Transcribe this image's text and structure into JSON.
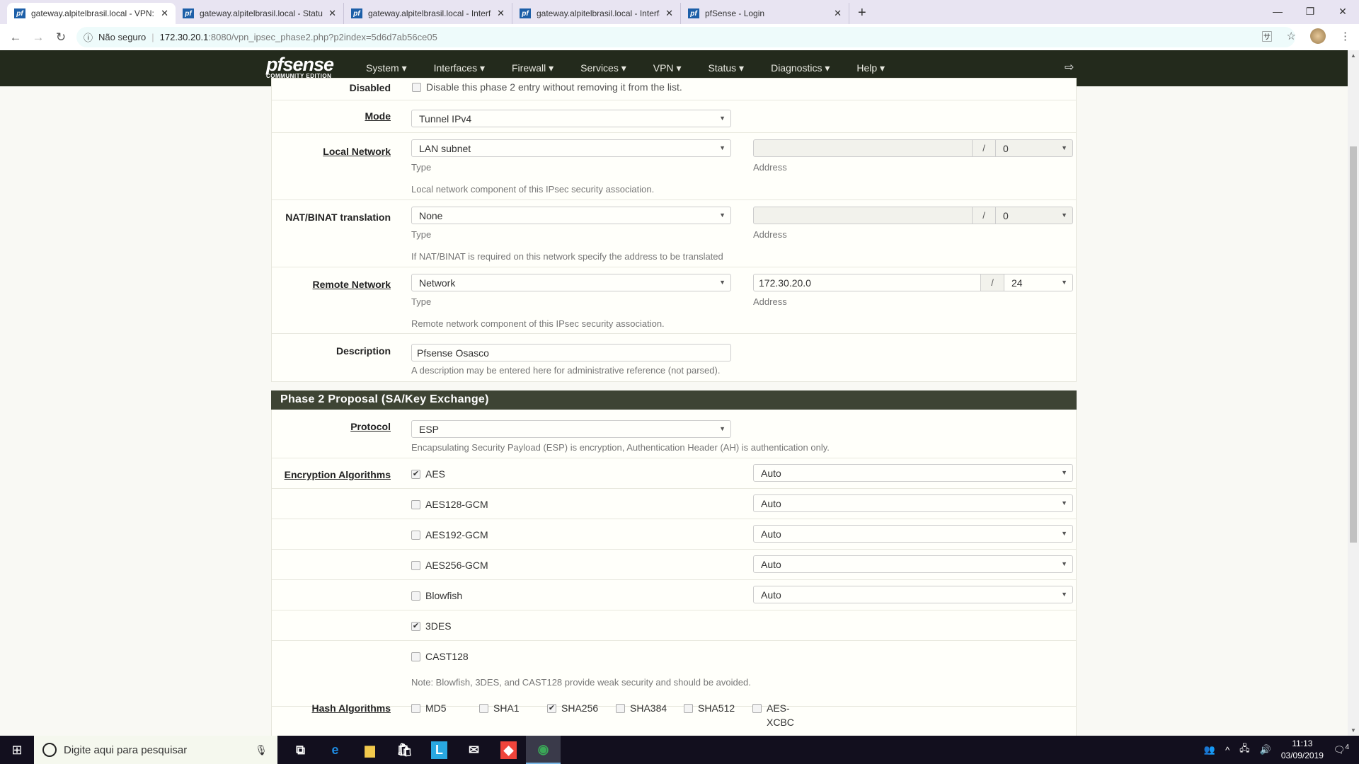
{
  "browser": {
    "tabs": [
      {
        "title": "gateway.alpitelbrasil.local - VPN: IPsec",
        "active": true
      },
      {
        "title": "gateway.alpitelbrasil.local - Status",
        "active": false
      },
      {
        "title": "gateway.alpitelbrasil.local - Interfaces",
        "active": false
      },
      {
        "title": "gateway.alpitelbrasil.local - Interfaces",
        "active": false
      },
      {
        "title": "pfSense - Login",
        "active": false
      }
    ],
    "security": "Não seguro",
    "url_host": "172.30.20.1",
    "url_path": ":8080/vpn_ipsec_phase2.php?p2index=5d6d7ab56ce05"
  },
  "navbar": {
    "logo": "pfsense",
    "edition": "COMMUNITY EDITION",
    "menu": [
      "System ▾",
      "Interfaces ▾",
      "Firewall ▾",
      "Services ▾",
      "VPN ▾",
      "Status ▾",
      "Diagnostics ▾",
      "Help ▾"
    ]
  },
  "form": {
    "disabled": {
      "label": "Disabled",
      "text": "Disable this phase 2 entry without removing it from the list.",
      "checked": false
    },
    "mode": {
      "label": "Mode",
      "value": "Tunnel IPv4"
    },
    "local_network": {
      "label": "Local Network",
      "type": "LAN subnet",
      "type_label": "Type",
      "address": "",
      "mask": "0",
      "address_label": "Address",
      "help": "Local network component of this IPsec security association."
    },
    "nat": {
      "label": "NAT/BINAT translation",
      "type": "None",
      "type_label": "Type",
      "address": "",
      "mask": "0",
      "address_label": "Address",
      "help": "If NAT/BINAT is required on this network specify the address to be translated"
    },
    "remote_network": {
      "label": "Remote Network",
      "type": "Network",
      "type_label": "Type",
      "address": "172.30.20.0",
      "mask": "24",
      "address_label": "Address",
      "help": "Remote network component of this IPsec security association."
    },
    "description": {
      "label": "Description",
      "value": "Pfsense Osasco",
      "help": "A description may be entered here for administrative reference (not parsed)."
    }
  },
  "phase2": {
    "title": "Phase 2 Proposal (SA/Key Exchange)",
    "protocol": {
      "label": "Protocol",
      "value": "ESP",
      "help": "Encapsulating Security Payload (ESP) is encryption, Authentication Header (AH) is authentication only."
    },
    "enc_label": "Encryption Algorithms",
    "algorithms": [
      {
        "name": "AES",
        "checked": true,
        "keylen": "Auto"
      },
      {
        "name": "AES128-GCM",
        "checked": false,
        "keylen": "Auto"
      },
      {
        "name": "AES192-GCM",
        "checked": false,
        "keylen": "Auto"
      },
      {
        "name": "AES256-GCM",
        "checked": false,
        "keylen": "Auto"
      },
      {
        "name": "Blowfish",
        "checked": false,
        "keylen": "Auto"
      },
      {
        "name": "3DES",
        "checked": true
      },
      {
        "name": "CAST128",
        "checked": false
      }
    ],
    "enc_note": "Note: Blowfish, 3DES, and CAST128 provide weak security and should be avoided.",
    "hash_label": "Hash Algorithms",
    "hashes": [
      {
        "name": "MD5",
        "checked": false
      },
      {
        "name": "SHA1",
        "checked": false
      },
      {
        "name": "SHA256",
        "checked": true
      },
      {
        "name": "SHA384",
        "checked": false
      },
      {
        "name": "SHA512",
        "checked": false
      },
      {
        "name": "AES-XCBC",
        "checked": false
      }
    ]
  },
  "taskbar": {
    "search_placeholder": "Digite aqui para pesquisar",
    "time": "11:13",
    "date": "03/09/2019",
    "notifications": "4"
  }
}
